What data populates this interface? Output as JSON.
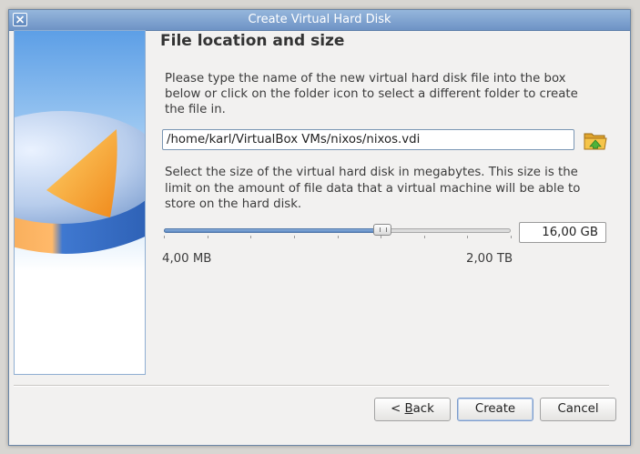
{
  "window": {
    "title": "Create Virtual Hard Disk",
    "close_icon": "close-icon"
  },
  "page": {
    "heading": "File location and size",
    "file_description": "Please type the name of the new virtual hard disk file into the box below or click on the folder icon to select a different folder to create the file in.",
    "file_path": "/home/karl/VirtualBox VMs/nixos/nixos.vdi",
    "folder_icon": "folder-open-icon",
    "size_description": "Select the size of the virtual hard disk in megabytes. This size is the limit on the amount of file data that a virtual machine will be able to store on the hard disk.",
    "size_value": "16,00 GB",
    "slider_position_fraction": 0.63,
    "min_label": "4,00 MB",
    "max_label": "2,00 TB"
  },
  "buttons": {
    "back_prefix": "< ",
    "back_mnemonic": "B",
    "back_rest": "ack",
    "create": "Create",
    "cancel": "Cancel"
  },
  "colors": {
    "titlebar": "#7ea3d2",
    "accent": "#5b86c0",
    "disk_orange": "#f59a2c",
    "disk_blue": "#3f78d0"
  }
}
